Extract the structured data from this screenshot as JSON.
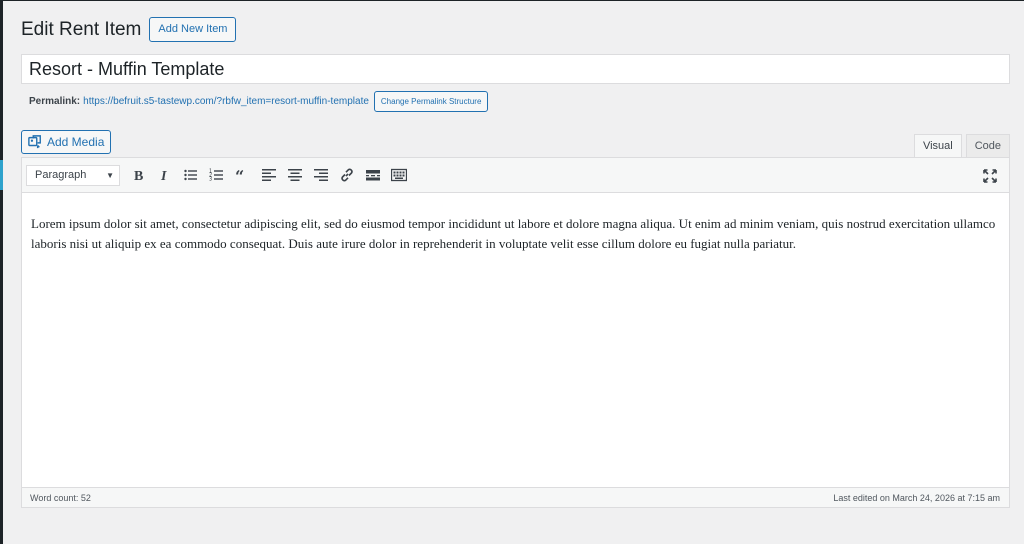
{
  "header": {
    "title": "Edit Rent Item",
    "add_new_label": "Add New Item"
  },
  "post": {
    "title_value": "Resort - Muffin Template"
  },
  "permalink": {
    "label": "Permalink:",
    "url": "https://befruit.s5-tastewp.com/?rbfw_item=resort-muffin-template",
    "change_button": "Change Permalink Structure"
  },
  "media": {
    "add_media_label": "Add Media"
  },
  "editor_tabs": [
    {
      "label": "Visual",
      "active": true
    },
    {
      "label": "Code",
      "active": false
    }
  ],
  "toolbar": {
    "format_selected": "Paragraph",
    "buttons": [
      "bold-icon",
      "italic-icon",
      "bulleted-list-icon",
      "numbered-list-icon",
      "blockquote-icon",
      "align-left-icon",
      "align-center-icon",
      "align-right-icon",
      "link-icon",
      "read-more-icon",
      "toolbar-toggle-icon"
    ],
    "fullscreen_icon": "fullscreen-icon"
  },
  "content": {
    "body": "Lorem ipsum dolor sit amet, consectetur adipiscing elit, sed do eiusmod tempor incididunt ut labore et dolore magna aliqua. Ut enim ad minim veniam, quis nostrud exercitation ullamco laboris nisi ut aliquip ex ea commodo consequat. Duis aute irure dolor in reprehenderit in voluptate velit esse cillum dolore eu fugiat nulla pariatur."
  },
  "status": {
    "word_count": "Word count: 52",
    "last_edited": "Last edited on March 24, 2026 at 7:15 am"
  },
  "colors": {
    "accent": "#2271b1",
    "background": "#f0f0f1"
  }
}
